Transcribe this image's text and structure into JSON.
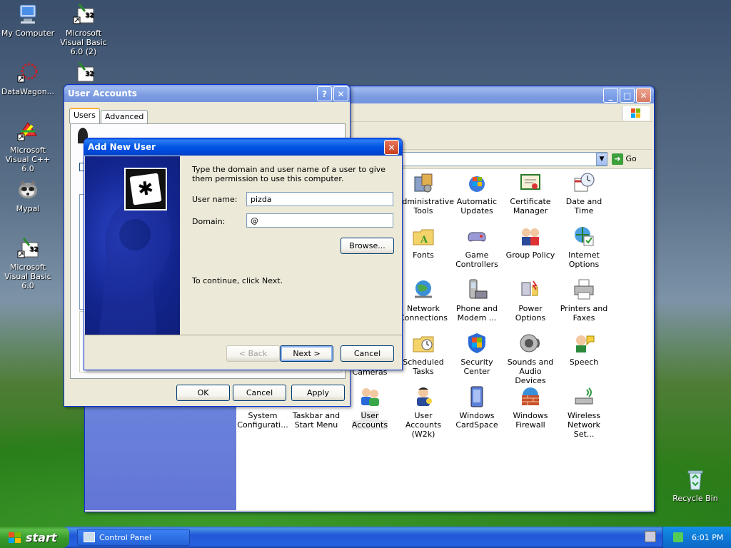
{
  "desktop": {
    "icons": [
      {
        "label": "My Computer"
      },
      {
        "label": "Microsoft Visual Basic 6.0 (2)"
      },
      {
        "label": "DataWagon..."
      },
      {
        "label": "Microsoft Visual C++ 6.0"
      },
      {
        "label": "Mypal"
      },
      {
        "label": "Microsoft Visual Basic 6.0"
      },
      {
        "label": "Recycle Bin"
      }
    ]
  },
  "control_panel": {
    "address_go": "Go",
    "items": [
      {
        "label": "Administrative Tools"
      },
      {
        "label": "Automatic Updates"
      },
      {
        "label": "Certificate Manager"
      },
      {
        "label": "Date and Time"
      },
      {
        "label": "Fonts"
      },
      {
        "label": "Game Controllers"
      },
      {
        "label": "Group Policy"
      },
      {
        "label": "Internet Options"
      },
      {
        "label": "Network Connections"
      },
      {
        "label": "Phone and Modem ..."
      },
      {
        "label": "Power Options"
      },
      {
        "label": "Printers and Faxes"
      },
      {
        "label": "Cameras"
      },
      {
        "label": "Scheduled Tasks"
      },
      {
        "label": "Security Center"
      },
      {
        "label": "Sounds and Audio Devices"
      },
      {
        "label": "Speech"
      },
      {
        "label": "System Configurati..."
      },
      {
        "label": "Taskbar and Start Menu"
      },
      {
        "label": "User Accounts"
      },
      {
        "label": "User Accounts (W2k)"
      },
      {
        "label": "Windows CardSpace"
      },
      {
        "label": "Windows Firewall"
      },
      {
        "label": "Wireless Network Set..."
      }
    ]
  },
  "user_accounts": {
    "title": "User Accounts",
    "tabs": [
      "Users",
      "Advanced"
    ],
    "ok": "OK",
    "cancel": "Cancel",
    "apply": "Apply"
  },
  "add_user": {
    "title": "Add New User",
    "instruction": "Type the domain and user name of a user to give them permission to use this computer.",
    "username_label": "User name:",
    "username_value": "pizda",
    "domain_label": "Domain:",
    "domain_value": "@",
    "browse": "Browse...",
    "continue_text": "To continue, click Next.",
    "back": "< Back",
    "next": "Next >",
    "cancel": "Cancel"
  },
  "taskbar": {
    "start": "start",
    "task": "Control Panel",
    "clock": "6:01 PM"
  },
  "colors": {
    "xp_blue": "#0054e3",
    "dialog_bg": "#ece9d8",
    "banner_dark": "#0b1a8c",
    "taskbar": "#245edb",
    "start_green": "#3c9a2a"
  }
}
